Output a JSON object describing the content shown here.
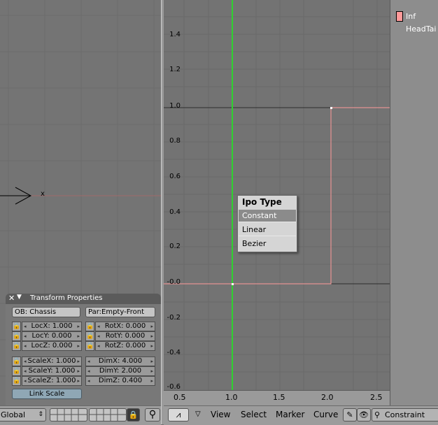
{
  "view3d": {
    "object_axis_label": "x"
  },
  "transform_panel": {
    "title": "Transform Properties",
    "object_name": "OB: Chassis",
    "parent_name": "Par:Empty-Front",
    "loc": [
      "LocX: 1.000",
      "LocY: 0.000",
      "LocZ: 0.000"
    ],
    "rot": [
      "RotX: 0.000",
      "RotY: 0.000",
      "RotZ: 0.000"
    ],
    "scale": [
      "ScaleX: 1.000",
      "ScaleY: 1.000",
      "ScaleZ: 1.000"
    ],
    "dim": [
      "DimX: 4.000",
      "DimY: 2.000",
      "DimZ: 0.400"
    ],
    "link_scale": "Link Scale"
  },
  "left_header": {
    "orientation": "Global"
  },
  "ipo_graph": {
    "y_ticks": [
      "1.4",
      "1.2",
      "1.0",
      "0.8",
      "0.6",
      "0.4",
      "0.2",
      "-0.0",
      "-0.2",
      "-0.4",
      "-0.6"
    ],
    "x_ticks": [
      "0.5",
      "1.0",
      "1.5",
      "2.0",
      "2.5"
    ],
    "curve_color": "#ff9a9a",
    "current_frame_color": "#2fd12f"
  },
  "popup": {
    "title": "Ipo Type",
    "items": [
      "Constant",
      "Linear",
      "Bezier"
    ],
    "active_item": "Constant"
  },
  "channels": {
    "channel_name": "Inf",
    "target": "HeadTai"
  },
  "ipo_header": {
    "menus": [
      "View",
      "Select",
      "Marker",
      "Curve"
    ],
    "ipo_type": "Constraint"
  }
}
